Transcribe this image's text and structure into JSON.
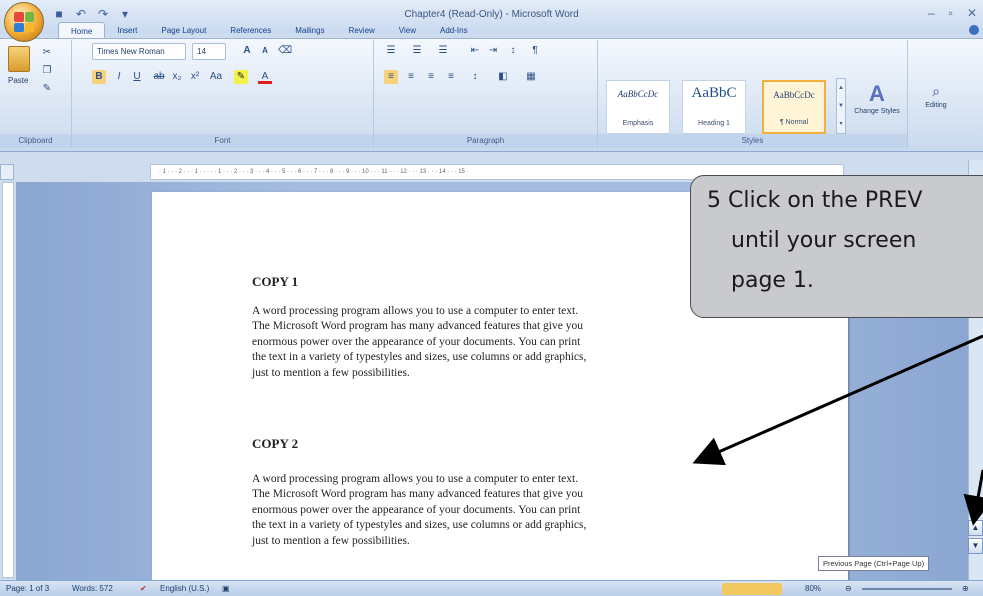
{
  "window": {
    "title": "Chapter4 (Read-Only) - Microsoft Word",
    "controls": [
      "–",
      "▫",
      "✕"
    ]
  },
  "ribbon": {
    "tabs": [
      {
        "label": "Home",
        "active": true
      },
      {
        "label": "Insert"
      },
      {
        "label": "Page Layout"
      },
      {
        "label": "References"
      },
      {
        "label": "Mailings"
      },
      {
        "label": "Review"
      },
      {
        "label": "View"
      },
      {
        "label": "Add-Ins"
      }
    ],
    "clipboard": {
      "paste_label": "Paste",
      "group_label": "Clipboard"
    },
    "font": {
      "font_name": "Times New Roman",
      "font_size": "14",
      "group_label": "Font",
      "case_label": "Aa"
    },
    "paragraph": {
      "group_label": "Paragraph"
    },
    "styles": {
      "group_label": "Styles",
      "items": [
        {
          "sample": "AaBbCcDc",
          "name": "Emphasis"
        },
        {
          "sample": "AaBbC",
          "name": "Heading 1"
        },
        {
          "sample": "AaBbCcDc",
          "name": "¶ Normal"
        }
      ],
      "change_styles_label": "Change Styles"
    },
    "editing": {
      "label": "Editing"
    }
  },
  "ruler": {
    "marks": "· 1 · · · 2 · · · 1 · · · · · 1 · · · 2 · · · 3 · · · 4 · · · 5 · · · 6 · · · 7 · · · 8 · · · 9 · · · 10 · · · 11 · · · 12 · · · 13 · · · 14 · · · 15 ·"
  },
  "document": {
    "sections": [
      {
        "heading": "COPY 1",
        "lines": [
          "A word processing program allows you to use a computer to enter text.",
          "The Microsoft Word program has many advanced features that give you",
          "enormous power over the appearance of your documents.  You can print",
          "the text in a variety of typestyles and sizes, use columns or add graphics,",
          "just to mention a few possibilities."
        ]
      },
      {
        "heading": "COPY 2",
        "lines": [
          "A word processing program allows you to use a computer to enter text.",
          "The Microsoft Word program has many advanced features that give you",
          "enormous power over the appearance of your documents.  You can print",
          "the text in a variety of typestyles and sizes, use columns or add graphics,",
          "just to mention a few possibilities."
        ]
      }
    ]
  },
  "scrollbar": {
    "prev_page_glyph": "▲",
    "next_page_glyph": "▼",
    "tooltip": "Previous Page (Ctrl+Page Up)"
  },
  "statusbar": {
    "page": "Page: 1 of 3",
    "words": "Words: 572",
    "language": "English (U.S.)",
    "zoom": "80%"
  },
  "callout": {
    "lines": [
      "5  Click on the PREV",
      "until your screen",
      "page 1."
    ]
  },
  "colors": {
    "ribbon_bg": "#dbe6f4",
    "doc_bg": "#a4bce0",
    "callout_bg": "#c9cacd"
  }
}
